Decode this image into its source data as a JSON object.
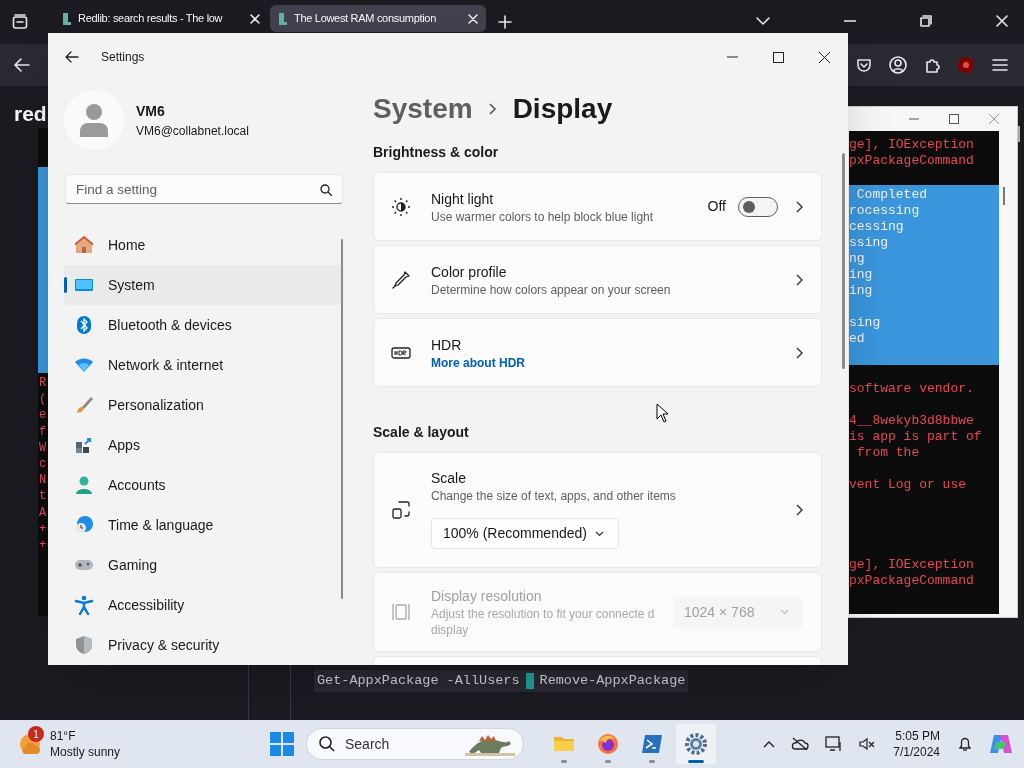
{
  "browser": {
    "tabs": [
      {
        "title": "Redlib: search results - The low",
        "selected": false
      },
      {
        "title": "The Lowest RAM consumption",
        "selected": true
      }
    ],
    "page": {
      "heading_fragment": "red",
      "code_before": "Get-AppxPackage -AllUsers",
      "code_after": "Remove-AppxPackage"
    }
  },
  "left_terminal": {
    "lines": [
      "R",
      "(",
      "e",
      "f",
      "W",
      "c",
      "N",
      "t",
      "A",
      "+",
      "+"
    ]
  },
  "terminal": {
    "lines": [
      {
        "kind": "error",
        "text": "ge], IOException"
      },
      {
        "kind": "error",
        "text": "pxPackageCommand"
      },
      {
        "kind": "blank"
      },
      {
        "kind": "selected",
        "text": " Completed"
      },
      {
        "kind": "selected",
        "text": "rocessing"
      },
      {
        "kind": "selected",
        "text": "cessing"
      },
      {
        "kind": "selected",
        "text": "ssing"
      },
      {
        "kind": "selected",
        "text": "ng"
      },
      {
        "kind": "selected",
        "text": "ing"
      },
      {
        "kind": "selected",
        "text": "ing"
      },
      {
        "kind": "selected-blank"
      },
      {
        "kind": "selected",
        "text": "sing"
      },
      {
        "kind": "selected",
        "text": "ed"
      },
      {
        "kind": "selected-blank"
      },
      {
        "kind": "blank"
      },
      {
        "kind": "error",
        "text": "software vendor."
      },
      {
        "kind": "blank"
      },
      {
        "kind": "error",
        "text": "4__8wekyb3d8bbwe"
      },
      {
        "kind": "error",
        "text": "is app is part of"
      },
      {
        "kind": "error",
        "text": " from the"
      },
      {
        "kind": "blank"
      },
      {
        "kind": "error",
        "text": "vent Log or use"
      },
      {
        "kind": "blank"
      },
      {
        "kind": "blank"
      },
      {
        "kind": "blank"
      },
      {
        "kind": "blank"
      },
      {
        "kind": "error",
        "text": "ge], IOException"
      },
      {
        "kind": "error",
        "text": "pxPackageCommand"
      }
    ]
  },
  "settings": {
    "title": "Settings",
    "user": {
      "name": "VM6",
      "email": "VM6@collabnet.local"
    },
    "search": {
      "placeholder": "Find a setting"
    },
    "nav": [
      {
        "label": "Home",
        "selected": false
      },
      {
        "label": "System",
        "selected": true
      },
      {
        "label": "Bluetooth & devices",
        "selected": false
      },
      {
        "label": "Network & internet",
        "selected": false
      },
      {
        "label": "Personalization",
        "selected": false
      },
      {
        "label": "Apps",
        "selected": false
      },
      {
        "label": "Accounts",
        "selected": false
      },
      {
        "label": "Time & language",
        "selected": false
      },
      {
        "label": "Gaming",
        "selected": false
      },
      {
        "label": "Accessibility",
        "selected": false
      },
      {
        "label": "Privacy & security",
        "selected": false
      }
    ],
    "breadcrumb": [
      "System",
      "Display"
    ],
    "sections": [
      {
        "title": "Brightness & color",
        "cards": [
          {
            "kind": "toggle",
            "title": "Night light",
            "subtitle": "Use warmer colors to help block blue light",
            "toggle_label": "Off",
            "on": false,
            "disabled": false
          },
          {
            "kind": "link",
            "title": "Color profile",
            "subtitle": "Determine how colors appear on your screen",
            "disabled": false
          },
          {
            "kind": "link",
            "title": "HDR",
            "link": "More about HDR",
            "disabled": false
          }
        ]
      },
      {
        "title": "Scale & layout",
        "cards": [
          {
            "kind": "scale",
            "title": "Scale",
            "subtitle": "Change the size of text, apps, and other items",
            "dropdown": "100% (Recommended)",
            "disabled": false
          },
          {
            "kind": "dropdown",
            "title": "Display resolution",
            "subtitle": "Adjust the resolution to fit your connecte d display",
            "dropdown": "1024 × 768",
            "disabled": true
          }
        ]
      }
    ]
  },
  "taskbar": {
    "weather": {
      "badge": "1",
      "temp": "81°F",
      "condition": "Mostly sunny"
    },
    "search": "Search",
    "apps": [
      {
        "selected": false
      },
      {
        "selected": false
      },
      {
        "selected": false
      },
      {
        "selected": true
      }
    ],
    "clock": {
      "time": "5:05 PM",
      "date": "7/1/2024"
    }
  }
}
